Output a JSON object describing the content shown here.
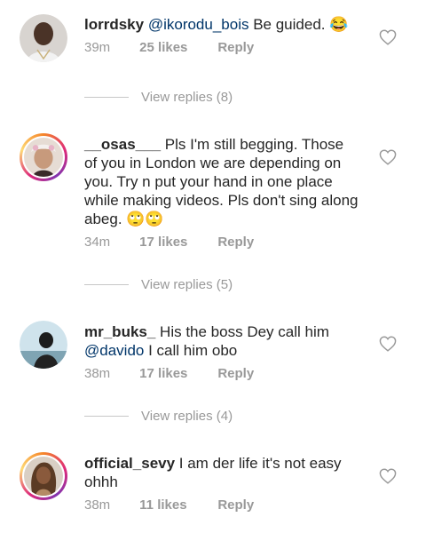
{
  "comments": [
    {
      "username": "lorrdsky",
      "mention": "@ikorodu_bois",
      "text": " Be guided. 😂",
      "time": "39m",
      "likes": "25 likes",
      "reply": "Reply"
    },
    {
      "username": "__osas___",
      "text": " Pls I'm still begging.  Those of you in London we are depending on you.  Try n put your hand in one place while making videos.  Pls don't sing along abeg. 🙄🙄",
      "time": "34m",
      "likes": "17 likes",
      "reply": "Reply"
    },
    {
      "username": "mr_buks_",
      "text_before": " His the boss Dey call him ",
      "mention": "@davido",
      "text_after": " I call him obo",
      "time": "38m",
      "likes": "17 likes",
      "reply": "Reply"
    },
    {
      "username": "official_sevy",
      "text": " I am der life it's not easy ohhh",
      "time": "38m",
      "likes": "11 likes",
      "reply": "Reply"
    }
  ],
  "view_replies": [
    "View replies (8)",
    "View replies (5)",
    "View replies (4)"
  ],
  "colors": {
    "mention": "#003569",
    "meta": "#999999",
    "text": "#262626"
  },
  "icons": {
    "like": "heart-outline-icon"
  }
}
